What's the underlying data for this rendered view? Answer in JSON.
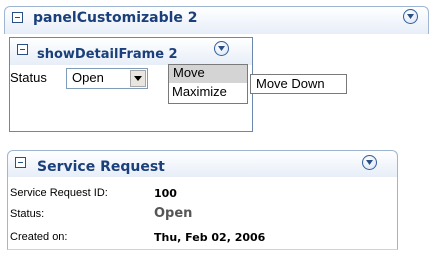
{
  "panel_customizable": {
    "title": "panelCustomizable 2"
  },
  "detail_frame": {
    "title": "showDetailFrame 2",
    "status_label": "Status",
    "status_value": "Open"
  },
  "context_menu": {
    "items": [
      "Move",
      "Maximize"
    ],
    "submenu_item": "Move Down"
  },
  "service_request": {
    "title": "Service Request",
    "fields": [
      {
        "label": "Service Request ID:",
        "value": "100"
      },
      {
        "label": "Status:",
        "value": "Open"
      },
      {
        "label": "Created on:",
        "value": "Thu, Feb 02, 2006"
      }
    ]
  },
  "colors": {
    "title_text": "#1a3f7a",
    "header_border": "#9fb6d3",
    "status_open_value": "#555555"
  }
}
